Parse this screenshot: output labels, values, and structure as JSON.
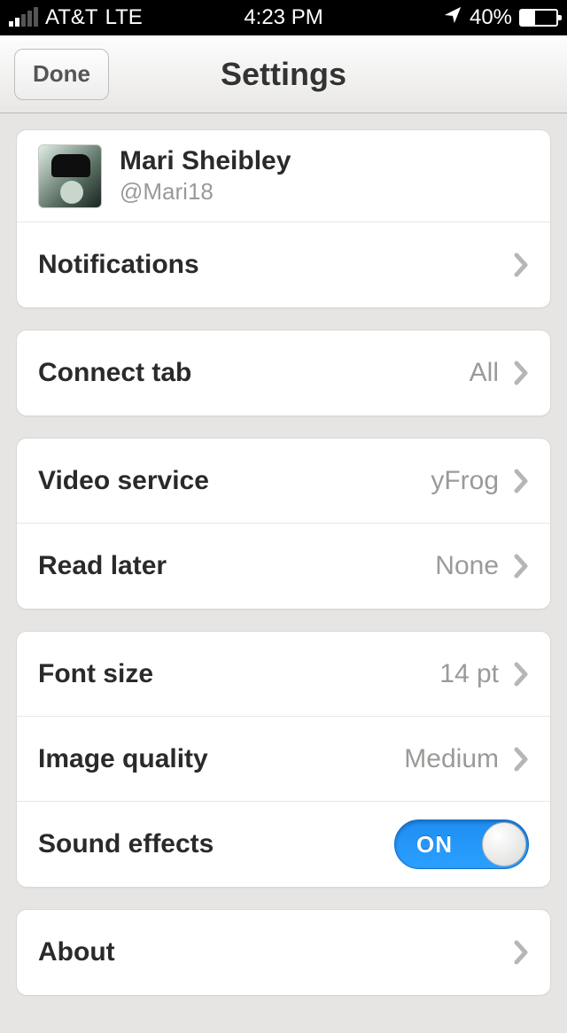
{
  "status": {
    "carrier": "AT&T",
    "network": "LTE",
    "time": "4:23 PM",
    "battery_pct": "40%"
  },
  "nav": {
    "done_label": "Done",
    "title": "Settings"
  },
  "account": {
    "name": "Mari Sheibley",
    "handle": "@Mari18"
  },
  "rows": {
    "notifications_label": "Notifications",
    "connect_tab_label": "Connect tab",
    "connect_tab_value": "All",
    "video_service_label": "Video service",
    "video_service_value": "yFrog",
    "read_later_label": "Read later",
    "read_later_value": "None",
    "font_size_label": "Font size",
    "font_size_value": "14 pt",
    "image_quality_label": "Image quality",
    "image_quality_value": "Medium",
    "sound_effects_label": "Sound effects",
    "sound_effects_toggle": "ON",
    "about_label": "About"
  }
}
